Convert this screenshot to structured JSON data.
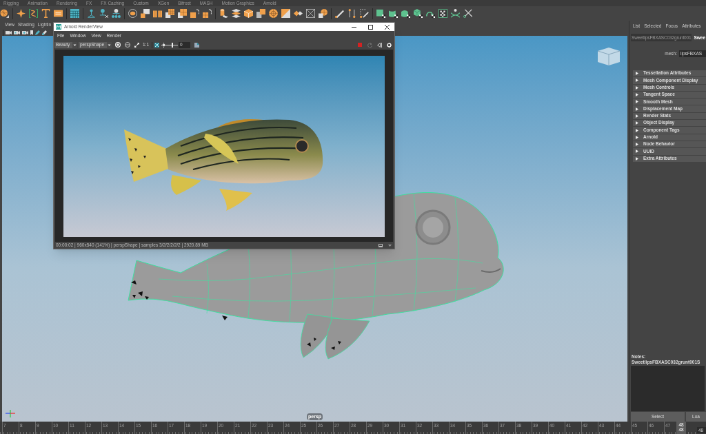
{
  "shelf": {
    "tabs": [
      {
        "label": "Rigging",
        "selected": false
      },
      {
        "label": "Animation",
        "selected": false
      },
      {
        "label": "Rendering",
        "selected": false
      },
      {
        "label": "FX",
        "selected": false
      },
      {
        "label": "FX Caching",
        "selected": false
      },
      {
        "label": "Custom",
        "selected": false
      },
      {
        "label": "XGen",
        "selected": false
      },
      {
        "label": "Bifrost",
        "selected": false
      },
      {
        "label": "MASH",
        "selected": false
      },
      {
        "label": "Motion Graphics",
        "selected": false
      },
      {
        "label": "Arnold",
        "selected": false
      }
    ]
  },
  "viewport": {
    "menu": [
      "View",
      "Shading",
      "Lightin"
    ],
    "camera": "persp"
  },
  "render_view": {
    "title": "Arnold RenderView",
    "menu": [
      "File",
      "Window",
      "View",
      "Render"
    ],
    "aov": "Beauty",
    "camera": "perspShape",
    "zoom": "1:1",
    "exposure": {
      "level": 0.5,
      "value": "0"
    },
    "status": "00:00:02 | 960x540 (141%) | perspShape | samples 3/2/2/2/2/2 | 2920.89 MB"
  },
  "attribute_editor": {
    "menu": [
      "List",
      "Selected",
      "Focus",
      "Attributes"
    ],
    "tabs": [
      {
        "label": "SweetlipsFBXASC032grunt001",
        "selected": false
      },
      {
        "label": "Swee",
        "selected": true
      }
    ],
    "mesh": {
      "label": "mesh:",
      "value": "lipsFBXAS"
    },
    "sections": [
      {
        "label": "Tessellation Attributes",
        "expanded": false
      },
      {
        "label": "Mesh Component Display",
        "expanded": false
      },
      {
        "label": "Mesh Controls",
        "expanded": false
      },
      {
        "label": "Tangent Space",
        "expanded": false
      },
      {
        "label": "Smooth Mesh",
        "expanded": false
      },
      {
        "label": "Displacement Map",
        "expanded": false
      },
      {
        "label": "Render Stats",
        "expanded": false
      },
      {
        "label": "Object Display",
        "expanded": false
      },
      {
        "label": "Component Tags",
        "expanded": false
      },
      {
        "label": "Arnold",
        "expanded": false
      },
      {
        "label": "Node Behavior",
        "expanded": false
      },
      {
        "label": "UUID",
        "expanded": false
      },
      {
        "label": "Extra Attributes",
        "expanded": false
      }
    ],
    "notes_title": "Notes: SweetlipsFBXASC032grunt001S",
    "buttons": [
      "Select",
      "Loa"
    ]
  },
  "timeline": {
    "frames": [
      {
        "label": "7",
        "selected": false
      },
      {
        "label": "8",
        "selected": false
      },
      {
        "label": "9",
        "selected": false
      },
      {
        "label": "10",
        "selected": false
      },
      {
        "label": "11",
        "selected": false
      },
      {
        "label": "12",
        "selected": false
      },
      {
        "label": "13",
        "selected": false
      },
      {
        "label": "14",
        "selected": false
      },
      {
        "label": "15",
        "selected": false
      },
      {
        "label": "16",
        "selected": false
      },
      {
        "label": "17",
        "selected": false
      },
      {
        "label": "18",
        "selected": false
      },
      {
        "label": "19",
        "selected": false
      },
      {
        "label": "20",
        "selected": false
      },
      {
        "label": "21",
        "selected": false
      },
      {
        "label": "22",
        "selected": false
      },
      {
        "label": "23",
        "selected": false
      },
      {
        "label": "24",
        "selected": false
      },
      {
        "label": "25",
        "selected": false
      },
      {
        "label": "26",
        "selected": false
      },
      {
        "label": "27",
        "selected": false
      },
      {
        "label": "28",
        "selected": false
      },
      {
        "label": "29",
        "selected": false
      },
      {
        "label": "30",
        "selected": false
      },
      {
        "label": "31",
        "selected": false
      },
      {
        "label": "32",
        "selected": false
      },
      {
        "label": "33",
        "selected": false
      },
      {
        "label": "34",
        "selected": false
      },
      {
        "label": "35",
        "selected": false
      },
      {
        "label": "36",
        "selected": false
      },
      {
        "label": "37",
        "selected": false
      },
      {
        "label": "38",
        "selected": false
      },
      {
        "label": "39",
        "selected": false
      },
      {
        "label": "40",
        "selected": false
      },
      {
        "label": "41",
        "selected": false
      },
      {
        "label": "42",
        "selected": false
      },
      {
        "label": "43",
        "selected": false
      },
      {
        "label": "44",
        "selected": false
      },
      {
        "label": "45",
        "selected": false
      },
      {
        "label": "46",
        "selected": false
      },
      {
        "label": "47",
        "selected": false
      },
      {
        "label": "48",
        "selected": true
      }
    ],
    "marker": "48",
    "current_frame": "48"
  }
}
